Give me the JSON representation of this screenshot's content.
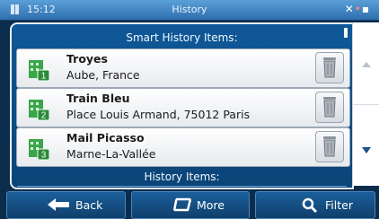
{
  "status": {
    "time": "15:12",
    "title": "History"
  },
  "smart_header": "Smart History Items:",
  "history_header": "History Items:",
  "items": [
    {
      "title": "Troyes",
      "subtitle": "Aube, France",
      "number": "1"
    },
    {
      "title": "Train Bleu",
      "subtitle": "Place Louis Armand, 75012 Paris",
      "number": "2"
    },
    {
      "title": "Mail Picasso",
      "subtitle": "Marne-La-Vallée",
      "number": "3"
    }
  ],
  "toolbar": {
    "back": "Back",
    "more": "More",
    "filter": "Filter"
  },
  "icons": {
    "location": "green-building-location-icon",
    "delete": "trash-can-icon",
    "back": "left-arrow-icon",
    "more": "rounded-rectangle-icon",
    "filter": "magnifier-icon"
  },
  "colors": {
    "accent_green": "#3aa64a",
    "panel_blue": "#0f5898",
    "header_blue": "#2e6fad"
  }
}
